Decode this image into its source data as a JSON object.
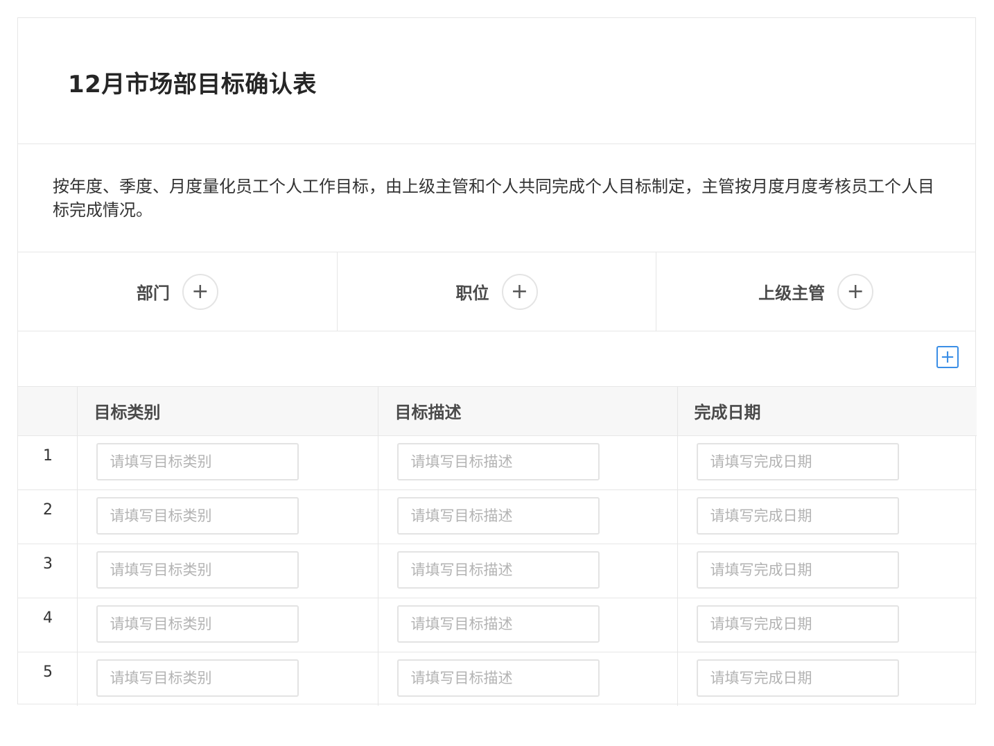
{
  "form": {
    "title": "12月市场部目标确认表",
    "description": "按年度、季度、月度量化员工个人工作目标，由上级主管和个人共同完成个人目标制定，主管按月度月度考核员工个人目标完成情况。"
  },
  "people": [
    {
      "label": "部门",
      "add_icon": "plus-circle-icon"
    },
    {
      "label": "职位",
      "add_icon": "plus-circle-icon"
    },
    {
      "label": "上级主管",
      "add_icon": "plus-circle-icon"
    }
  ],
  "toolbar": {
    "add_row_icon": "plus-square-icon",
    "accent": "#3a8ee6"
  },
  "table": {
    "headers": [
      "",
      "目标类别",
      "目标描述",
      "完成日期"
    ],
    "rows": [
      {
        "index": "1",
        "category": "",
        "description": "",
        "date": ""
      },
      {
        "index": "2",
        "category": "",
        "description": "",
        "date": ""
      },
      {
        "index": "3",
        "category": "",
        "description": "",
        "date": ""
      },
      {
        "index": "4",
        "category": "",
        "description": "",
        "date": ""
      },
      {
        "index": "5",
        "category": "",
        "description": "",
        "date": ""
      }
    ],
    "placeholders": {
      "category": "请填写目标类别",
      "description": "请填写目标描述",
      "date": "请填写完成日期"
    }
  }
}
